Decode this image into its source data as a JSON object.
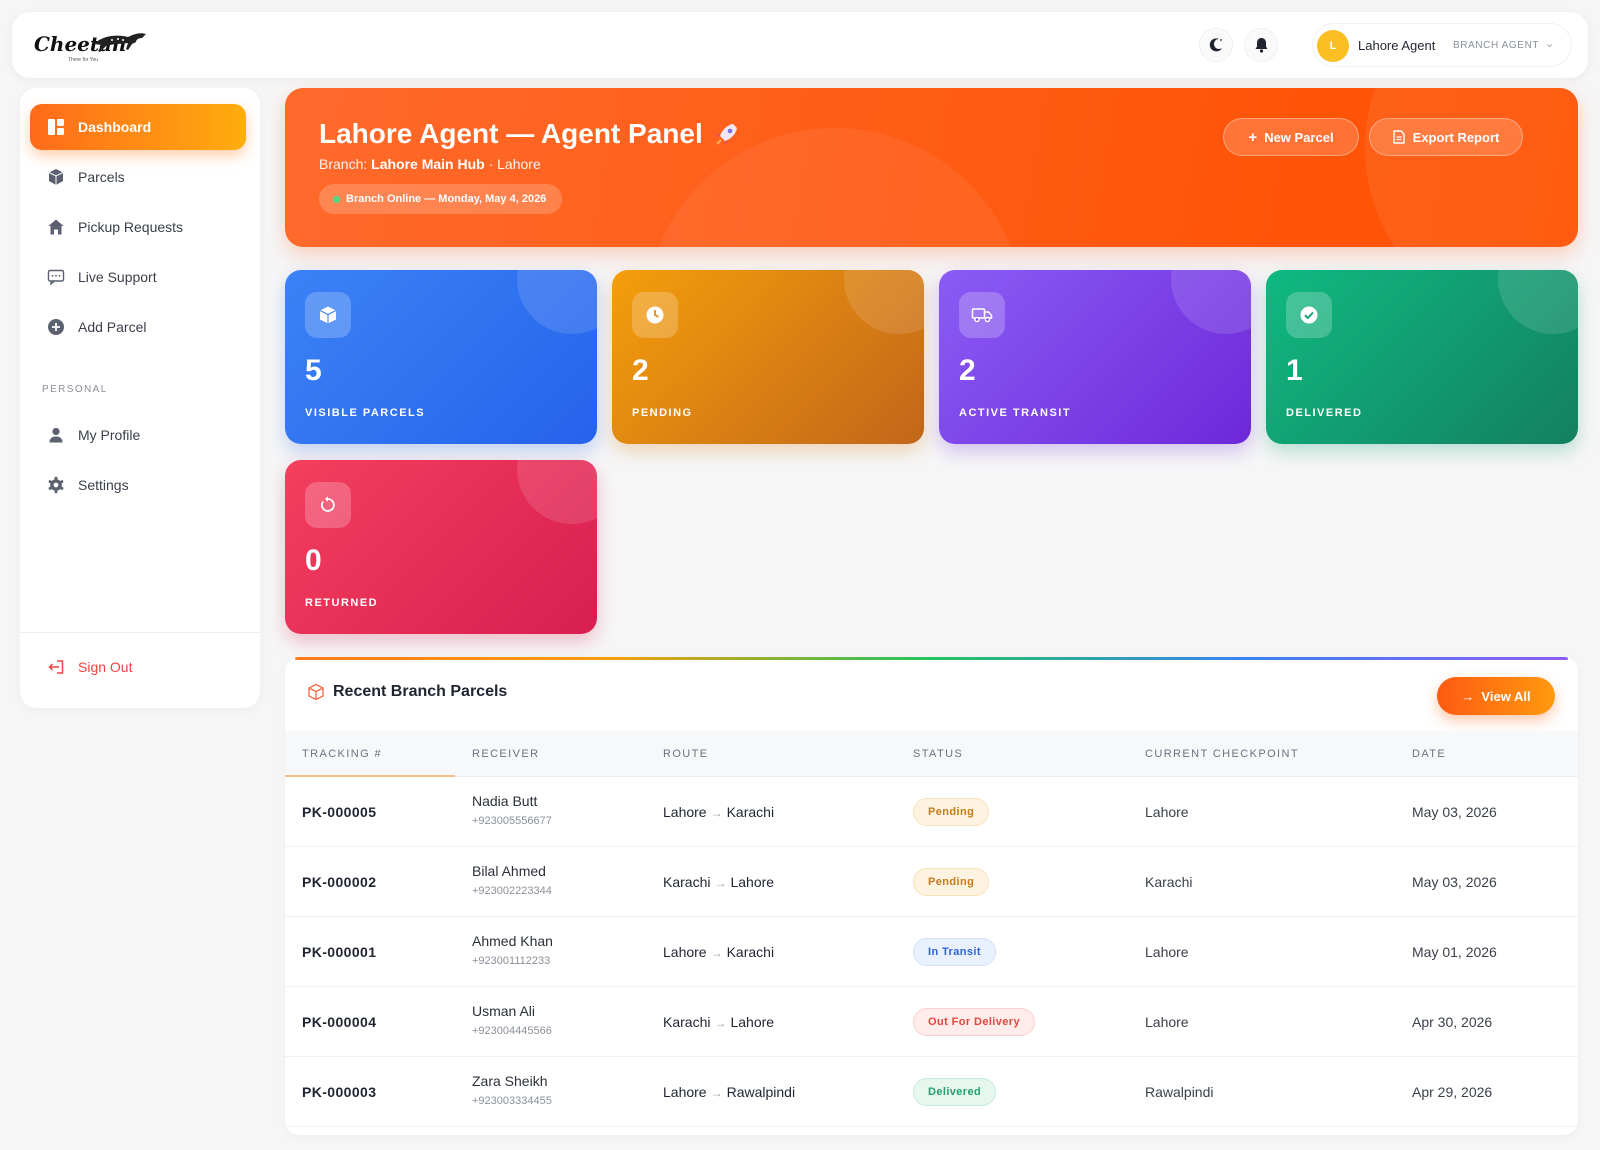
{
  "brand": {
    "name": "Cheetah",
    "tagline": "There for You"
  },
  "topbar": {
    "user_initial": "L",
    "user_name": "Lahore Agent",
    "user_role": "BRANCH AGENT"
  },
  "sidebar": {
    "items": [
      {
        "label": "Dashboard",
        "icon": "dashboard-icon"
      },
      {
        "label": "Parcels",
        "icon": "box-icon"
      },
      {
        "label": "Pickup Requests",
        "icon": "home-icon"
      },
      {
        "label": "Live Support",
        "icon": "chat-icon"
      },
      {
        "label": "Add Parcel",
        "icon": "plus-circle-icon"
      }
    ],
    "section_personal": "PERSONAL",
    "personal_items": [
      {
        "label": "My Profile",
        "icon": "user-icon"
      },
      {
        "label": "Settings",
        "icon": "gear-icon"
      }
    ],
    "signout_label": "Sign Out"
  },
  "hero": {
    "title": "Lahore Agent — Agent Panel",
    "branch_prefix": "Branch:",
    "branch_name": "Lahore Main Hub",
    "branch_city": "· Lahore",
    "status_pill": "Branch Online — Monday, May 4, 2026",
    "new_parcel_label": "New Parcel",
    "export_label": "Export Report"
  },
  "stats": [
    {
      "value": "5",
      "label": "VISIBLE PARCELS",
      "icon": "box-icon",
      "color": "#2563eb"
    },
    {
      "value": "2",
      "label": "PENDING",
      "icon": "clock-icon",
      "color": "#d97706"
    },
    {
      "value": "2",
      "label": "ACTIVE TRANSIT",
      "icon": "truck-icon",
      "color": "#6d28d9"
    },
    {
      "value": "1",
      "label": "DELIVERED",
      "icon": "check-circle-icon",
      "color": "#059669"
    },
    {
      "value": "0",
      "label": "RETURNED",
      "icon": "refresh-icon",
      "color": "#e11d48"
    }
  ],
  "recent": {
    "title": "Recent Branch Parcels",
    "view_all_label": "View All",
    "columns": [
      "TRACKING #",
      "RECEIVER",
      "ROUTE",
      "STATUS",
      "CURRENT CHECKPOINT",
      "DATE"
    ],
    "rows": [
      {
        "tracking": "PK-000005",
        "receiver": "Nadia Butt",
        "phone": "+923005556677",
        "from": "Lahore",
        "to": "Karachi",
        "status": "Pending",
        "checkpoint": "Lahore",
        "date": "May 03, 2026"
      },
      {
        "tracking": "PK-000002",
        "receiver": "Bilal Ahmed",
        "phone": "+923002223344",
        "from": "Karachi",
        "to": "Lahore",
        "status": "Pending",
        "checkpoint": "Karachi",
        "date": "May 03, 2026"
      },
      {
        "tracking": "PK-000001",
        "receiver": "Ahmed Khan",
        "phone": "+923001112233",
        "from": "Lahore",
        "to": "Karachi",
        "status": "In Transit",
        "checkpoint": "Lahore",
        "date": "May 01, 2026"
      },
      {
        "tracking": "PK-000004",
        "receiver": "Usman Ali",
        "phone": "+923004445566",
        "from": "Karachi",
        "to": "Lahore",
        "status": "Out For Delivery",
        "checkpoint": "Lahore",
        "date": "Apr 30, 2026"
      },
      {
        "tracking": "PK-000003",
        "receiver": "Zara Sheikh",
        "phone": "+923003334455",
        "from": "Lahore",
        "to": "Rawalpindi",
        "status": "Delivered",
        "checkpoint": "Rawalpindi",
        "date": "Apr 29, 2026"
      }
    ],
    "route_arrow": "→"
  }
}
